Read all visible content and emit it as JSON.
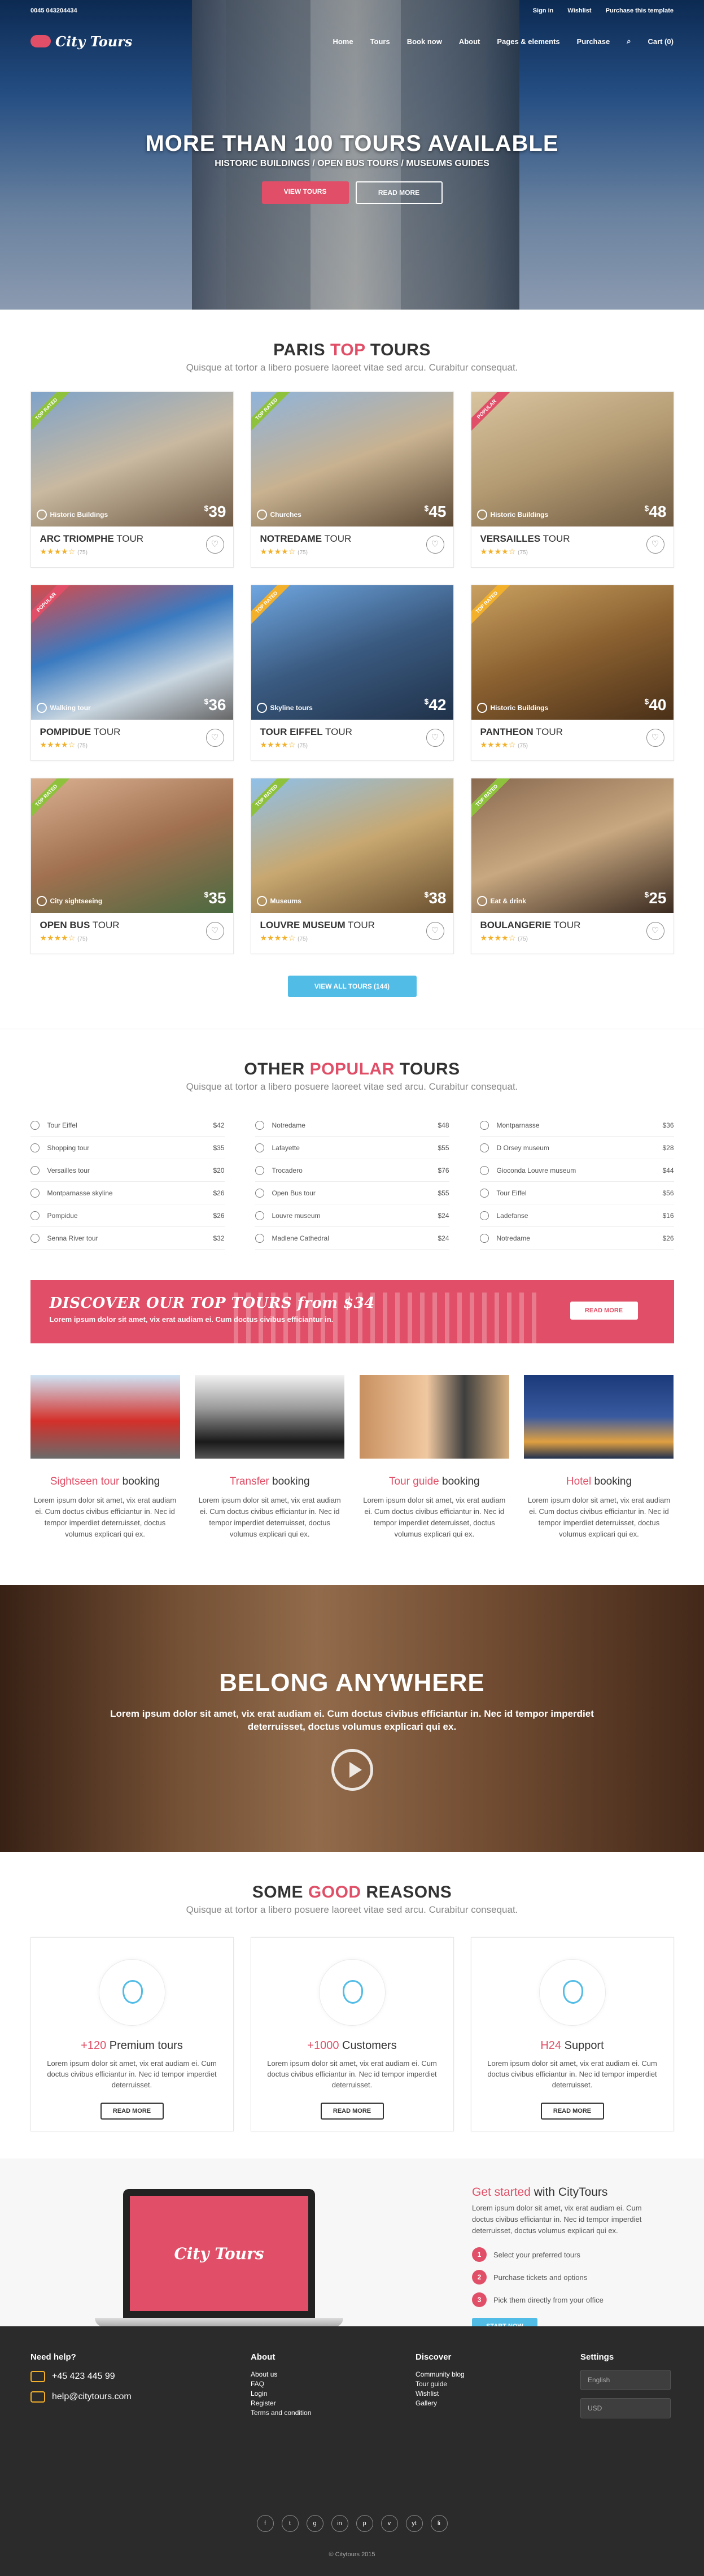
{
  "topbar": {
    "phone": "0045 043204434",
    "signin": "Sign in",
    "wishlist": "Wishlist",
    "purchase": "Purchase this template"
  },
  "nav": {
    "logo": "City Tours",
    "items": [
      "Home",
      "Tours",
      "Book now",
      "About",
      "Pages & elements",
      "Purchase"
    ],
    "cart": "Cart (0)"
  },
  "hero": {
    "title": "MORE THAN 100 TOURS AVAILABLE",
    "subtitle": "HISTORIC BUILDINGS / OPEN BUS TOURS / MUSEUMS GUIDES",
    "btn_view": "VIEW TOURS",
    "btn_read": "READ MORE"
  },
  "top_tours": {
    "title_a": "PARIS ",
    "title_b": "TOP",
    "title_c": " TOURS",
    "subtitle": "Quisque at tortor a libero posuere laoreet vitae sed arcu. Curabitur consequat.",
    "view_all": "VIEW ALL TOURS (144)",
    "items": [
      {
        "name": "ARC TRIOMPHE",
        "suffix": " TOUR",
        "cat": "Historic Buildings",
        "price": "39",
        "ribbon": "TOP RATED",
        "rc": "#8fc23c",
        "rating": "(75)"
      },
      {
        "name": "NOTREDAME",
        "suffix": " TOUR",
        "cat": "Churches",
        "price": "45",
        "ribbon": "TOP RATED",
        "rc": "#8fc23c",
        "rating": "(75)"
      },
      {
        "name": "VERSAILLES",
        "suffix": " TOUR",
        "cat": "Historic Buildings",
        "price": "48",
        "ribbon": "POPULAR",
        "rc": "#e04f67",
        "rating": "(75)"
      },
      {
        "name": "POMPIDUE",
        "suffix": " TOUR",
        "cat": "Walking tour",
        "price": "36",
        "ribbon": "POPULAR",
        "rc": "#e04f67",
        "rating": "(75)"
      },
      {
        "name": "TOUR EIFFEL",
        "suffix": " TOUR",
        "cat": "Skyline tours",
        "price": "42",
        "ribbon": "TOP RATED",
        "rc": "#f2b02b",
        "rating": "(75)"
      },
      {
        "name": "PANTHEON",
        "suffix": " TOUR",
        "cat": "Historic Buildings",
        "price": "40",
        "ribbon": "TOP RATED",
        "rc": "#f2b02b",
        "rating": "(75)"
      },
      {
        "name": "OPEN BUS",
        "suffix": " TOUR",
        "cat": "City sightseeing",
        "price": "35",
        "ribbon": "TOP RATED",
        "rc": "#8fc23c",
        "rating": "(75)"
      },
      {
        "name": "LOUVRE MUSEUM",
        "suffix": " TOUR",
        "cat": "Museums",
        "price": "38",
        "ribbon": "TOP RATED",
        "rc": "#8fc23c",
        "rating": "(75)"
      },
      {
        "name": "BOULANGERIE",
        "suffix": " TOUR",
        "cat": "Eat & drink",
        "price": "25",
        "ribbon": "TOP RATED",
        "rc": "#8fc23c",
        "rating": "(75)"
      }
    ]
  },
  "popular": {
    "title_a": "OTHER ",
    "title_b": "POPULAR",
    "title_c": " TOURS",
    "subtitle": "Quisque at tortor a libero posuere laoreet vitae sed arcu. Curabitur consequat.",
    "cols": [
      [
        [
          "Tour Eiffel",
          "$42"
        ],
        [
          "Shopping tour",
          "$35"
        ],
        [
          "Versailles tour",
          "$20"
        ],
        [
          "Montparnasse skyline",
          "$26"
        ],
        [
          "Pompidue",
          "$26"
        ],
        [
          "Senna River tour",
          "$32"
        ]
      ],
      [
        [
          "Notredame",
          "$48"
        ],
        [
          "Lafayette",
          "$55"
        ],
        [
          "Trocadero",
          "$76"
        ],
        [
          "Open Bus tour",
          "$55"
        ],
        [
          "Louvre museum",
          "$24"
        ],
        [
          "Madlene Cathedral",
          "$24"
        ]
      ],
      [
        [
          "Montparnasse",
          "$36"
        ],
        [
          "D Orsey museum",
          "$28"
        ],
        [
          "Gioconda Louvre museum",
          "$44"
        ],
        [
          "Tour Eiffel",
          "$56"
        ],
        [
          "Ladefanse",
          "$16"
        ],
        [
          "Notredame",
          "$26"
        ]
      ]
    ]
  },
  "banner": {
    "title": "DISCOVER OUR TOP TOURS from $34",
    "text": "Lorem ipsum dolor sit amet, vix erat audiam ei. Cum doctus civibus efficiantur in.",
    "btn": "READ MORE"
  },
  "services": [
    {
      "a": "Sightseen tour",
      "b": " booking",
      "text": "Lorem ipsum dolor sit amet, vix erat audiam ei. Cum doctus civibus efficiantur in. Nec id tempor imperdiet deterruisset, doctus volumus explicari qui ex."
    },
    {
      "a": "Transfer",
      "b": " booking",
      "text": "Lorem ipsum dolor sit amet, vix erat audiam ei. Cum doctus civibus efficiantur in. Nec id tempor imperdiet deterruisset, doctus volumus explicari qui ex."
    },
    {
      "a": "Tour guide",
      "b": " booking",
      "text": "Lorem ipsum dolor sit amet, vix erat audiam ei. Cum doctus civibus efficiantur in. Nec id tempor imperdiet deterruisset, doctus volumus explicari qui ex."
    },
    {
      "a": "Hotel",
      "b": " booking",
      "text": "Lorem ipsum dolor sit amet, vix erat audiam ei. Cum doctus civibus efficiantur in. Nec id tempor imperdiet deterruisset, doctus volumus explicari qui ex."
    }
  ],
  "belong": {
    "title": "BELONG ANYWHERE",
    "text": "Lorem ipsum dolor sit amet, vix erat audiam ei. Cum doctus civibus efficiantur in. Nec id tempor imperdiet deterruisset, doctus volumus explicari qui ex."
  },
  "reasons": {
    "title_a": "SOME ",
    "title_b": "GOOD",
    "title_c": " REASONS",
    "subtitle": "Quisque at tortor a libero posuere laoreet vitae sed arcu. Curabitur consequat.",
    "items": [
      {
        "a": "+120",
        "b": " Premium tours",
        "text": "Lorem ipsum dolor sit amet, vix erat audiam ei. Cum doctus civibus efficiantur in. Nec id tempor imperdiet deterruisset.",
        "btn": "READ MORE",
        "icon": "map-pin-icon"
      },
      {
        "a": "+1000",
        "b": " Customers",
        "text": "Lorem ipsum dolor sit amet, vix erat audiam ei. Cum doctus civibus efficiantur in. Nec id tempor imperdiet deterruisset.",
        "btn": "READ MORE",
        "icon": "walker-icon"
      },
      {
        "a": "H24",
        "b": " Support",
        "text": "Lorem ipsum dolor sit amet, vix erat audiam ei. Cum doctus civibus efficiantur in. Nec id tempor imperdiet deterruisset.",
        "btn": "READ MORE",
        "icon": "headset-icon"
      }
    ]
  },
  "started": {
    "title_a": "Get started",
    "title_b": " with CityTours",
    "text": "Lorem ipsum dolor sit amet, vix erat audiam ei. Cum doctus civibus efficiantur in. Nec id tempor imperdiet deterruisset, doctus volumus explicari qui ex.",
    "steps": [
      "Select your preferred tours",
      "Purchase tickets and options",
      "Pick them directly from your office"
    ],
    "btn": "START NOW",
    "screen_logo": "City Tours"
  },
  "footer": {
    "help": "Need help?",
    "phone": "+45 423 445 99",
    "email": "help@citytours.com",
    "about": {
      "title": "About",
      "links": [
        "About us",
        "FAQ",
        "Login",
        "Register",
        "Terms and condition"
      ]
    },
    "discover": {
      "title": "Discover",
      "links": [
        "Community blog",
        "Tour guide",
        "Wishlist",
        "Gallery"
      ]
    },
    "settings": {
      "title": "Settings",
      "lang": "English",
      "currency": "USD"
    },
    "socials": [
      "f",
      "t",
      "g",
      "in",
      "p",
      "v",
      "yt",
      "li"
    ],
    "copy": "© Citytours 2015"
  },
  "colors": {
    "accent": "#e04f67",
    "blue": "#51bce6",
    "star": "#f2b02b",
    "footer": "#2b2b2b"
  }
}
